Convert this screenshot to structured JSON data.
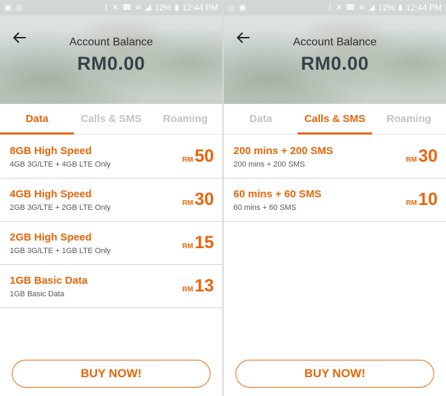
{
  "status_bar": {
    "battery": "12%",
    "time": "12:44 PM",
    "left_icons": [
      "gallery-icon",
      "location-icon"
    ],
    "right_icons": [
      "bluetooth-icon",
      "mute-icon",
      "call-icon",
      "wifi-icon",
      "signal-icon",
      "battery-icon"
    ]
  },
  "header": {
    "title": "Account Balance",
    "balance": "RM0.00"
  },
  "tabs": [
    "Data",
    "Calls & SMS",
    "Roaming"
  ],
  "left_panel": {
    "active_tab": 0,
    "plans": [
      {
        "name": "8GB High Speed",
        "desc": "4GB 3G/LTE + 4GB LTE Only",
        "currency": "RM",
        "amount": "50"
      },
      {
        "name": "4GB High Speed",
        "desc": "2GB 3G/LTE + 2GB LTE Only",
        "currency": "RM",
        "amount": "30"
      },
      {
        "name": "2GB High Speed",
        "desc": "1GB 3G/LTE + 1GB LTE Only",
        "currency": "RM",
        "amount": "15"
      },
      {
        "name": "1GB Basic Data",
        "desc": "1GB Basic Data",
        "currency": "RM",
        "amount": "13"
      }
    ]
  },
  "right_panel": {
    "active_tab": 1,
    "plans": [
      {
        "name": "200 mins + 200 SMS",
        "desc": "200 mins + 200 SMS",
        "currency": "RM",
        "amount": "30"
      },
      {
        "name": "60 mins + 60 SMS",
        "desc": "60 mins + 60 SMS",
        "currency": "RM",
        "amount": "10"
      }
    ]
  },
  "buy_button": "BUY NOW!",
  "colors": {
    "accent": "#e8650a",
    "inactive_tab": "#c3c3c3",
    "divider": "#d4d4d4"
  }
}
